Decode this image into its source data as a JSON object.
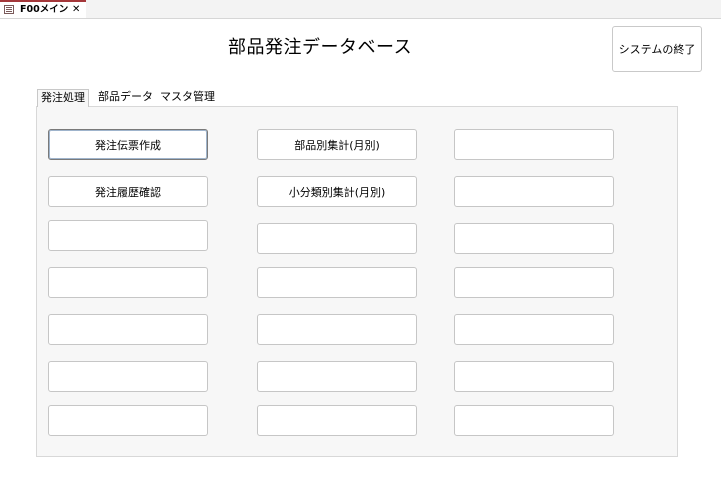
{
  "document_tab": {
    "label": "F00メイン",
    "close_symbol": "✕",
    "icon": "form-icon"
  },
  "header": {
    "title": "部品発注データベース",
    "exit_button_label": "システムの終了"
  },
  "tabs": [
    {
      "label": "発注処理",
      "active": true
    },
    {
      "label": "部品データ",
      "active": false
    },
    {
      "label": "マスタ管理",
      "active": false
    }
  ],
  "buttons": {
    "col1": [
      "発注伝票作成",
      "発注履歴確認",
      "",
      "",
      "",
      "",
      ""
    ],
    "col2": [
      "部品別集計(月別)",
      "小分類別集計(月別)",
      "",
      "",
      "",
      "",
      ""
    ],
    "col3": [
      "",
      "",
      "",
      "",
      "",
      "",
      ""
    ]
  }
}
